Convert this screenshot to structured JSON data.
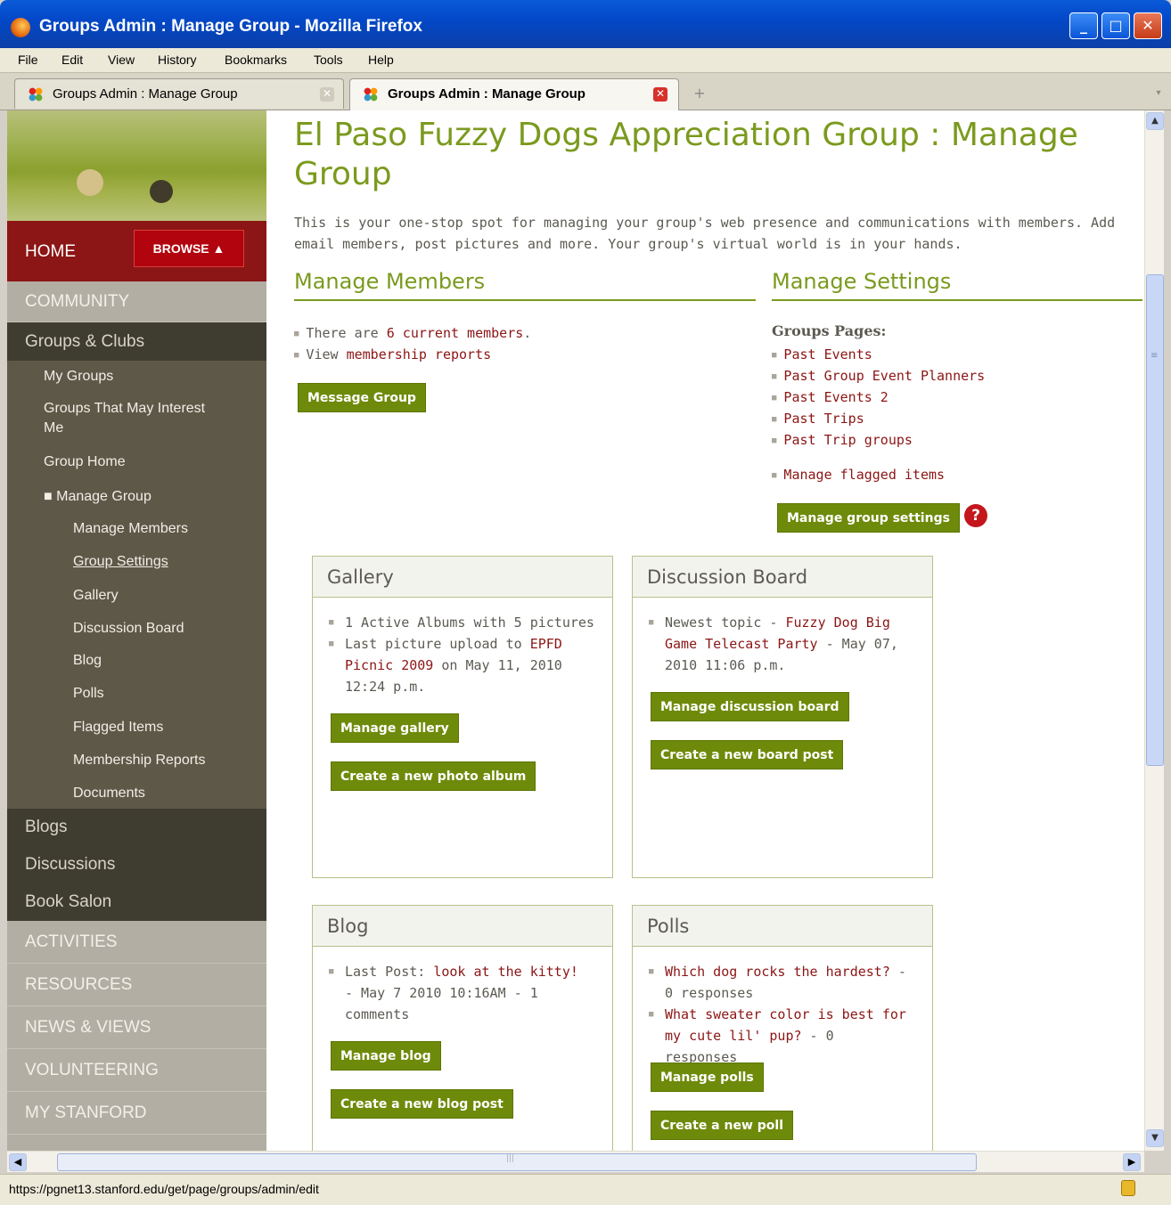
{
  "window": {
    "title": "Groups Admin : Manage Group - Mozilla Firefox",
    "min_label": "_",
    "max_label": "□",
    "close_label": "✕"
  },
  "menu": [
    "File",
    "Edit",
    "View",
    "History",
    "Bookmarks",
    "Tools",
    "Help"
  ],
  "tabs": [
    {
      "label": "Groups Admin : Manage Group",
      "close": "✕"
    },
    {
      "label": "Groups Admin : Manage Group",
      "close": "✕"
    }
  ],
  "new_tab": "+",
  "status_url": "https://pgnet13.stanford.edu/get/page/groups/admin/edit",
  "sidebar": {
    "home": "HOME",
    "browse": "BROWSE ▲",
    "sections": {
      "community": "COMMUNITY",
      "groups_clubs": "Groups & Clubs",
      "blogs": "Blogs",
      "discussions": "Discussions",
      "book_salon": "Book Salon",
      "activities": "ACTIVITIES",
      "resources": "RESOURCES",
      "news_views": "NEWS & VIEWS",
      "volunteering": "VOLUNTEERING",
      "my_stanford": "MY STANFORD"
    },
    "group_items": {
      "my_groups": "My Groups",
      "interest_1": "Groups That May Interest",
      "interest_2": "Me",
      "group_home": "Group Home",
      "manage_group": "■ Manage Group"
    },
    "manage_items": {
      "members": "Manage Members",
      "settings": "Group Settings",
      "gallery": "Gallery",
      "board": "Discussion Board",
      "blog": "Blog",
      "polls": "Polls",
      "flagged": "Flagged Items",
      "reports": "Membership Reports",
      "documents": "Documents"
    }
  },
  "main": {
    "title": "El Paso Fuzzy Dogs Appreciation Group : Manage Group",
    "intro": "This is your one-stop spot for managing your group's web presence and communications with members. Add email members, post pictures and more. Your group's virtual world is in your hands.",
    "members": {
      "heading": "Manage Members",
      "line1_pre": "There are ",
      "line1_link": "6 current members",
      "line1_post": ".",
      "line2_pre": "View ",
      "line2_link": "membership reports",
      "button": "Message Group"
    },
    "settings": {
      "heading": "Manage Settings",
      "pages_label": "Groups Pages:",
      "pages": [
        "Past Events",
        "Past Group Event Planners",
        "Past Events 2",
        "Past Trips",
        "Past Trip groups"
      ],
      "flagged": "Manage flagged items",
      "button": "Manage group settings",
      "help": "?"
    },
    "gallery": {
      "heading": "Gallery",
      "line1": "1 Active Albums with 5 pictures",
      "line2_pre": "Last picture upload to ",
      "line2_link": "EPFD Picnic 2009",
      "line2_post": " on May 11, 2010 12:24 p.m.",
      "btn1": "Manage gallery",
      "btn2": "Create a new photo album"
    },
    "board": {
      "heading": "Discussion Board",
      "line_pre": "Newest topic - ",
      "line_link": "Fuzzy Dog Big Game Telecast Party",
      "line_post": " - May 07, 2010 11:06 p.m.",
      "btn1": "Manage discussion board",
      "btn2": "Create a new board post"
    },
    "blog": {
      "heading": "Blog",
      "line_pre": "Last Post: ",
      "line_link": "look at the kitty!",
      "line_post": " - May 7 2010 10:16AM - 1 comments",
      "btn1": "Manage blog",
      "btn2": "Create a new blog post"
    },
    "polls": {
      "heading": "Polls",
      "p1_link": "Which dog rocks the hardest?",
      "p1_post": " - 0 responses",
      "p2_link": "What sweater color is best for my cute lil' pup?",
      "p2_post": " - 0 responses",
      "btn1": "Manage polls",
      "btn2": "Create a new poll"
    }
  },
  "colors": {
    "accent_green": "#7b9a1e",
    "button_green": "#6e8a0a",
    "link_red": "#8c1515",
    "home_red": "#8c1515"
  }
}
